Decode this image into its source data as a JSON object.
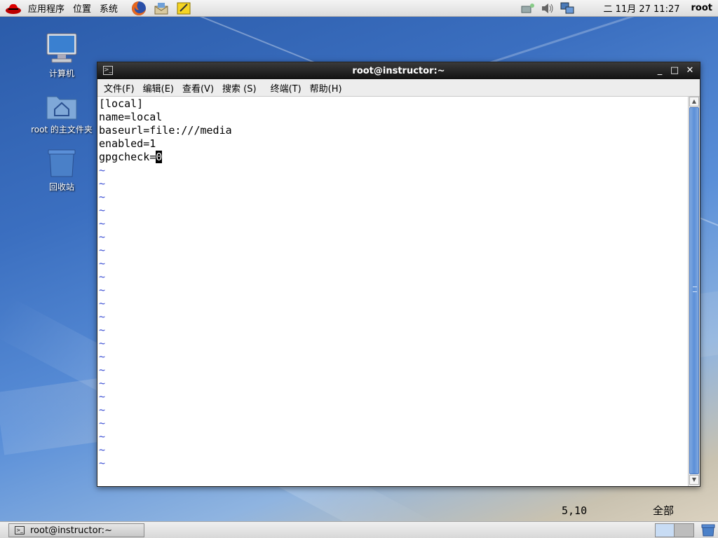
{
  "top_panel": {
    "menus": [
      "应用程序",
      "位置",
      "系统"
    ],
    "clock": "二 11月 27 11:27",
    "user": "root"
  },
  "desktop": {
    "icons": [
      {
        "label": "计算机",
        "icon": "computer-icon"
      },
      {
        "label": "root 的主文件夹",
        "icon": "home-folder-icon"
      },
      {
        "label": "回收站",
        "icon": "trash-icon"
      }
    ]
  },
  "window": {
    "title": "root@instructor:~",
    "menus": [
      "文件(F)",
      "编辑(E)",
      "查看(V)",
      "搜索 (S)",
      "终端(T)",
      "帮助(H)"
    ],
    "lines": [
      "[local]",
      "name=local",
      "baseurl=file:///media",
      "enabled=1",
      "gpgcheck="
    ],
    "cursor_char": "0",
    "tilde": "~",
    "status_pos": "5,10",
    "status_range": "全部"
  },
  "taskbar": {
    "button_label": "root@instructor:~"
  },
  "colors": {
    "tilde": "#3b4fd4",
    "scroll_thumb": "#5b8fd8"
  }
}
